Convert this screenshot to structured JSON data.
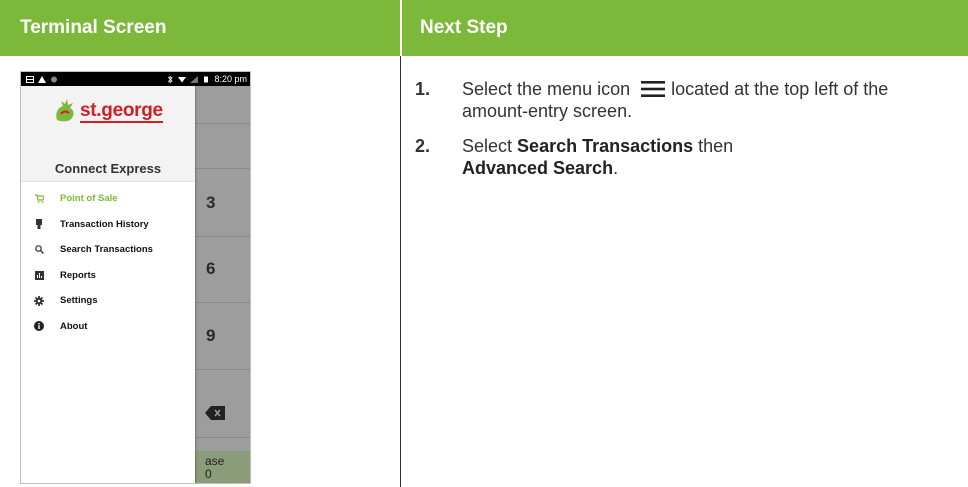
{
  "header": {
    "left": "Terminal Screen",
    "right": "Next Step"
  },
  "phone": {
    "status_time": "8:20 pm",
    "brand": "st.george",
    "app_title": "Connect Express",
    "menu": [
      {
        "label": "Point of Sale",
        "icon": "cart-icon",
        "active": true
      },
      {
        "label": "Transaction History",
        "icon": "receipt-icon",
        "active": false
      },
      {
        "label": "Search Transactions",
        "icon": "search-icon",
        "active": false
      },
      {
        "label": "Reports",
        "icon": "reports-icon",
        "active": false
      },
      {
        "label": "Settings",
        "icon": "gear-icon",
        "active": false
      },
      {
        "label": "About",
        "icon": "info-icon",
        "active": false
      }
    ],
    "keys": [
      "3",
      "6",
      "9"
    ],
    "green_button_partial": [
      "ase",
      "0"
    ]
  },
  "steps": {
    "s1": {
      "num": "1.",
      "before": "Select the menu icon",
      "after": "located at the top left of the amount-entry screen."
    },
    "s2": {
      "num": "2.",
      "before": "Select",
      "b1": "Search Transactions",
      "mid": "then",
      "b2": "Advanced Search",
      "end": "."
    }
  },
  "colors": {
    "accent": "#7cb83a",
    "brand_red": "#d21f26"
  }
}
